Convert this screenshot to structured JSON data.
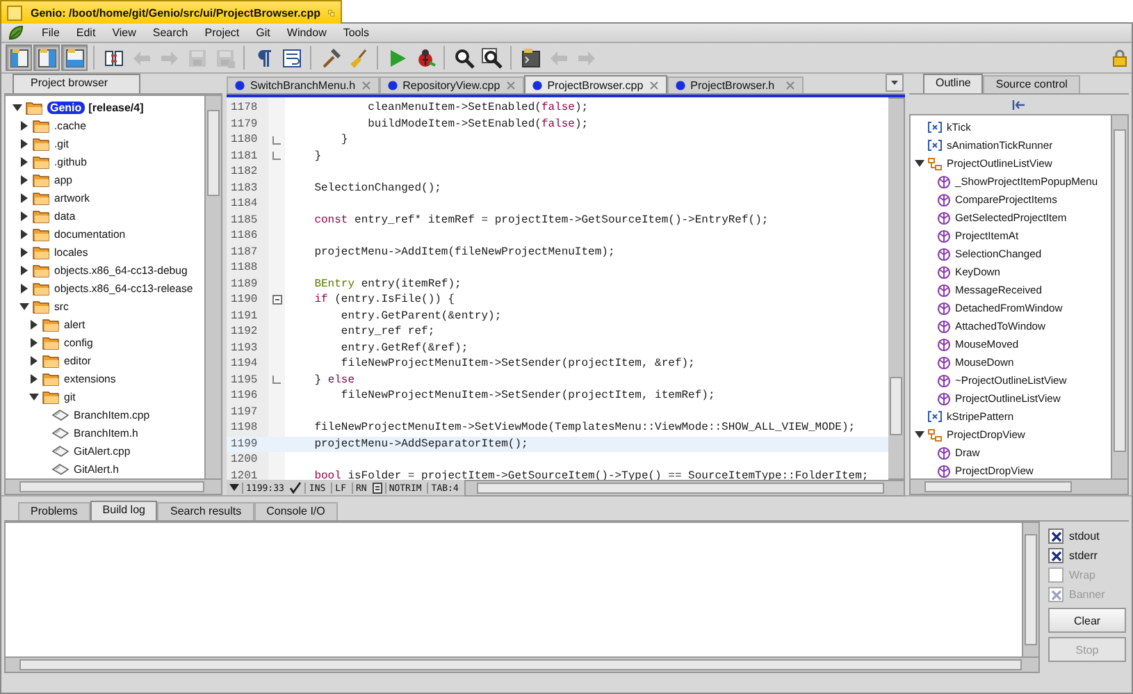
{
  "window": {
    "title": "Genio: /boot/home/git/Genio/src/ui/ProjectBrowser.cpp"
  },
  "menu": [
    "File",
    "Edit",
    "View",
    "Search",
    "Project",
    "Git",
    "Window",
    "Tools"
  ],
  "toolbar_groups": [
    [
      {
        "on": true,
        "disabled": false
      },
      {
        "on": true,
        "disabled": false
      },
      {
        "on": true,
        "disabled": false
      }
    ],
    [
      {
        "on": false,
        "disabled": false
      },
      {
        "on": false,
        "disabled": true
      },
      {
        "on": false,
        "disabled": true
      },
      {
        "on": false,
        "disabled": true
      },
      {
        "on": false,
        "disabled": true
      }
    ],
    [
      {
        "on": false,
        "disabled": false
      },
      {
        "on": false,
        "disabled": false
      }
    ],
    [
      {
        "on": false,
        "disabled": false
      },
      {
        "on": false,
        "disabled": false
      }
    ],
    [
      {
        "on": false,
        "disabled": false
      },
      {
        "on": false,
        "disabled": false
      }
    ],
    [
      {
        "on": false,
        "disabled": false
      },
      {
        "on": false,
        "disabled": false
      }
    ],
    [
      {
        "on": false,
        "disabled": false
      },
      {
        "on": false,
        "disabled": true
      },
      {
        "on": false,
        "disabled": true
      }
    ]
  ],
  "left_panel": {
    "tabs": [
      {
        "label": "Project browser",
        "selected": true
      }
    ]
  },
  "tree": {
    "project": {
      "name": "Genio",
      "branch": "[release/4]",
      "expanded": true,
      "children": [
        {
          "kind": "folder",
          "label": ".cache",
          "expanded": false
        },
        {
          "kind": "folder",
          "label": ".git",
          "expanded": false
        },
        {
          "kind": "folder",
          "label": ".github",
          "expanded": false
        },
        {
          "kind": "folder",
          "label": "app",
          "expanded": false
        },
        {
          "kind": "folder",
          "label": "artwork",
          "expanded": false
        },
        {
          "kind": "folder",
          "label": "data",
          "expanded": false
        },
        {
          "kind": "folder",
          "label": "documentation",
          "expanded": false
        },
        {
          "kind": "folder",
          "label": "locales",
          "expanded": false
        },
        {
          "kind": "folder",
          "label": "objects.x86_64-cc13-debug",
          "expanded": false
        },
        {
          "kind": "folder",
          "label": "objects.x86_64-cc13-release",
          "expanded": false
        },
        {
          "kind": "folder",
          "label": "src",
          "expanded": true,
          "children": [
            {
              "kind": "folder",
              "label": "alert",
              "expanded": false
            },
            {
              "kind": "folder",
              "label": "config",
              "expanded": false
            },
            {
              "kind": "folder",
              "label": "editor",
              "expanded": false
            },
            {
              "kind": "folder",
              "label": "extensions",
              "expanded": false
            },
            {
              "kind": "folder",
              "label": "git",
              "expanded": true,
              "children": [
                {
                  "kind": "file",
                  "label": "BranchItem.cpp"
                },
                {
                  "kind": "file",
                  "label": "BranchItem.h"
                },
                {
                  "kind": "file",
                  "label": "GitAlert.cpp"
                },
                {
                  "kind": "file",
                  "label": "GitAlert.h"
                }
              ]
            }
          ]
        }
      ]
    }
  },
  "editor": {
    "tabs": [
      {
        "label": "SwitchBranchMenu.h",
        "selected": false
      },
      {
        "label": "RepositoryView.cpp",
        "selected": false
      },
      {
        "label": "ProjectBrowser.cpp",
        "selected": true
      },
      {
        "label": "ProjectBrowser.h",
        "selected": false
      }
    ],
    "lines": [
      {
        "number": "1178",
        "fold_start": false,
        "fold_end": false,
        "current": false,
        "segments": [
          {
            "kind": "plain",
            "text": "            cleanMenuItem->SetEnabled("
          },
          {
            "kind": "keyword",
            "text": "false"
          },
          {
            "kind": "plain",
            "text": ");"
          }
        ]
      },
      {
        "number": "1179",
        "fold_start": false,
        "fold_end": false,
        "current": false,
        "segments": [
          {
            "kind": "plain",
            "text": "            buildModeItem->SetEnabled("
          },
          {
            "kind": "keyword",
            "text": "false"
          },
          {
            "kind": "plain",
            "text": ");"
          }
        ]
      },
      {
        "number": "1180",
        "fold_start": false,
        "fold_end": true,
        "current": false,
        "segments": [
          {
            "kind": "plain",
            "text": "        }"
          }
        ]
      },
      {
        "number": "1181",
        "fold_start": false,
        "fold_end": true,
        "current": false,
        "segments": [
          {
            "kind": "plain",
            "text": "    }"
          }
        ]
      },
      {
        "number": "1182",
        "fold_start": false,
        "fold_end": false,
        "current": false
      },
      {
        "number": "1183",
        "fold_start": false,
        "fold_end": false,
        "current": false,
        "segments": [
          {
            "kind": "plain",
            "text": "    SelectionChanged();"
          }
        ]
      },
      {
        "number": "1184",
        "fold_start": false,
        "fold_end": false,
        "current": false
      },
      {
        "number": "1185",
        "fold_start": false,
        "fold_end": false,
        "current": false,
        "segments": [
          {
            "kind": "keyword",
            "text": "    const"
          },
          {
            "kind": "plain",
            "text": " entry_ref* itemRef = projectItem->GetSourceItem()->EntryRef();"
          }
        ]
      },
      {
        "number": "1186",
        "fold_start": false,
        "fold_end": false,
        "current": false
      },
      {
        "number": "1187",
        "fold_start": false,
        "fold_end": false,
        "current": false,
        "segments": [
          {
            "kind": "plain",
            "text": "    projectMenu->AddItem(fileNewProjectMenuItem);"
          }
        ]
      },
      {
        "number": "1188",
        "fold_start": false,
        "fold_end": false,
        "current": false
      },
      {
        "number": "1189",
        "fold_start": false,
        "fold_end": false,
        "current": false,
        "segments": [
          {
            "kind": "type",
            "text": "    BEntry"
          },
          {
            "kind": "plain",
            "text": " entry(itemRef);"
          }
        ]
      },
      {
        "number": "1190",
        "fold_start": true,
        "fold_end": false,
        "current": false,
        "segments": [
          {
            "kind": "keyword",
            "text": "    if"
          },
          {
            "kind": "plain",
            "text": " (entry.IsFile()) {"
          }
        ]
      },
      {
        "number": "1191",
        "fold_start": false,
        "fold_end": false,
        "current": false,
        "segments": [
          {
            "kind": "plain",
            "text": "        entry.GetParent(&entry);"
          }
        ]
      },
      {
        "number": "1192",
        "fold_start": false,
        "fold_end": false,
        "current": false,
        "segments": [
          {
            "kind": "plain",
            "text": "        entry_ref ref;"
          }
        ]
      },
      {
        "number": "1193",
        "fold_start": false,
        "fold_end": false,
        "current": false,
        "segments": [
          {
            "kind": "plain",
            "text": "        entry.GetRef(&ref);"
          }
        ]
      },
      {
        "number": "1194",
        "fold_start": false,
        "fold_end": false,
        "current": false,
        "segments": [
          {
            "kind": "plain",
            "text": "        fileNewProjectMenuItem->SetSender(projectItem, &ref);"
          }
        ]
      },
      {
        "number": "1195",
        "fold_start": false,
        "fold_end": true,
        "current": false,
        "segments": [
          {
            "kind": "plain",
            "text": "    } "
          },
          {
            "kind": "keyword",
            "text": "else"
          }
        ]
      },
      {
        "number": "1196",
        "fold_start": false,
        "fold_end": false,
        "current": false,
        "segments": [
          {
            "kind": "plain",
            "text": "        fileNewProjectMenuItem->SetSender(projectItem, itemRef);"
          }
        ]
      },
      {
        "number": "1197",
        "fold_start": false,
        "fold_end": false,
        "current": false
      },
      {
        "number": "1198",
        "fold_start": false,
        "fold_end": false,
        "current": false,
        "segments": [
          {
            "kind": "plain",
            "text": "    fileNewProjectMenuItem->SetViewMode(TemplatesMenu::ViewMode::SHOW_ALL_VIEW_MODE);"
          }
        ]
      },
      {
        "number": "1199",
        "fold_start": false,
        "fold_end": false,
        "current": true,
        "segments": [
          {
            "kind": "plain",
            "text": "    projectMenu->AddSeparatorItem();"
          }
        ]
      },
      {
        "number": "1200",
        "fold_start": false,
        "fold_end": false,
        "current": false
      },
      {
        "number": "1201",
        "fold_start": false,
        "fold_end": false,
        "current": false,
        "segments": [
          {
            "kind": "keyword",
            "text": "    bool"
          },
          {
            "kind": "plain",
            "text": " isFolder = projectItem->GetSourceItem()->Type() == SourceItemType::FolderItem;"
          }
        ]
      }
    ],
    "status": {
      "position": "1199:33",
      "fields_before": [
        "INS",
        "LF",
        "RN"
      ],
      "fields_after": [
        "NOTRIM",
        "TAB:4"
      ]
    }
  },
  "right_panel": {
    "tabs": [
      {
        "label": "Outline",
        "selected": true
      },
      {
        "label": "Source control",
        "selected": false
      }
    ]
  },
  "outline": [
    {
      "kind": "constant",
      "label": "kTick"
    },
    {
      "kind": "constant",
      "label": "sAnimationTickRunner"
    },
    {
      "kind": "class",
      "label": "ProjectOutlineListView",
      "expanded": true,
      "children": [
        {
          "kind": "method",
          "label": "_ShowProjectItemPopupMenu"
        },
        {
          "kind": "method",
          "label": "CompareProjectItems"
        },
        {
          "kind": "method",
          "label": "GetSelectedProjectItem"
        },
        {
          "kind": "method",
          "label": "ProjectItemAt"
        },
        {
          "kind": "method",
          "label": "SelectionChanged"
        },
        {
          "kind": "method",
          "label": "KeyDown"
        },
        {
          "kind": "method",
          "label": "MessageReceived"
        },
        {
          "kind": "method",
          "label": "DetachedFromWindow"
        },
        {
          "kind": "method",
          "label": "AttachedToWindow"
        },
        {
          "kind": "method",
          "label": "MouseMoved"
        },
        {
          "kind": "method",
          "label": "MouseDown"
        },
        {
          "kind": "method",
          "label": "~ProjectOutlineListView"
        },
        {
          "kind": "method",
          "label": "ProjectOutlineListView"
        }
      ]
    },
    {
      "kind": "constant",
      "label": "kStripePattern"
    },
    {
      "kind": "class",
      "label": "ProjectDropView",
      "expanded": true,
      "children": [
        {
          "kind": "method",
          "label": "Draw"
        },
        {
          "kind": "method",
          "label": "ProjectDropView"
        }
      ]
    }
  ],
  "bottom_panel": {
    "tabs": [
      {
        "label": "Problems",
        "selected": false
      },
      {
        "label": "Build log",
        "selected": true
      },
      {
        "label": "Search results",
        "selected": false
      },
      {
        "label": "Console I/O",
        "selected": false
      }
    ],
    "options": [
      {
        "label": "stdout",
        "checked": true,
        "disabled": false
      },
      {
        "label": "stderr",
        "checked": true,
        "disabled": false
      },
      {
        "label": "Wrap",
        "checked": false,
        "disabled": true
      },
      {
        "label": "Banner",
        "checked": true,
        "disabled": true
      }
    ],
    "buttons": [
      {
        "label": "Clear",
        "disabled": false
      },
      {
        "label": "Stop",
        "disabled": true
      }
    ]
  }
}
